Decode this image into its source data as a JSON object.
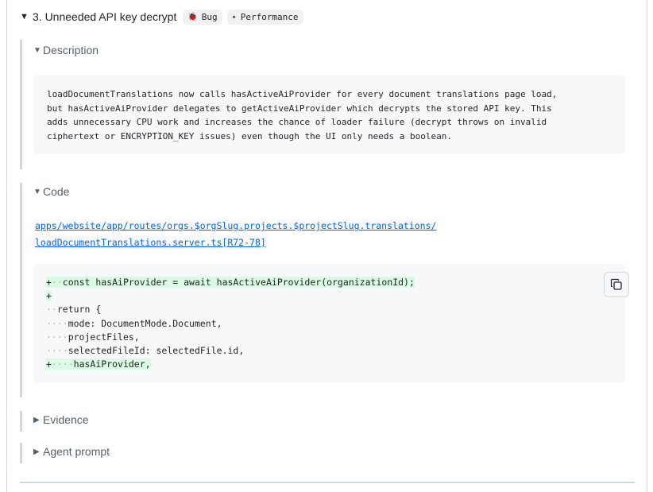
{
  "issue": {
    "caret": "▼",
    "title": "3. Unneeded API key decrypt",
    "tags": [
      {
        "icon": "bug-icon",
        "label": "Bug"
      },
      {
        "icon": "sparkle-icon",
        "label": "Performance"
      }
    ]
  },
  "description": {
    "caret": "▼",
    "label": "Description",
    "text": "loadDocumentTranslations now calls hasActiveAiProvider for every document translations page load,\nbut hasActiveAiProvider delegates to getActiveAiProvider which decrypts the stored API key. This\nadds unnecessary CPU work and increases the chance of loader failure (decrypt throws on invalid\nciphertext or ENCRYPTION_KEY issues) even though the UI only needs a boolean."
  },
  "code": {
    "caret": "▼",
    "label": "Code",
    "path_line1": "apps/website/app/routes/orgs.$orgSlug.projects.$projectSlug.translations/",
    "path_line2": "loadDocumentTranslations.server.ts[R72-78]",
    "lines": [
      {
        "added": true,
        "marker": "+",
        "ws": "··",
        "text": "const hasAiProvider = await hasActiveAiProvider(organizationId);"
      },
      {
        "added": true,
        "marker": "+",
        "ws": "",
        "text": ""
      },
      {
        "added": false,
        "marker": "",
        "ws": "··",
        "text": "return {"
      },
      {
        "added": false,
        "marker": "",
        "ws": "····",
        "text": "mode: DocumentMode.Document,"
      },
      {
        "added": false,
        "marker": "",
        "ws": "····",
        "text": "projectFiles,"
      },
      {
        "added": false,
        "marker": "",
        "ws": "····",
        "text": "selectedFileId: selectedFile.id,"
      },
      {
        "added": true,
        "marker": "+",
        "ws": "····",
        "text": "hasAiProvider,"
      }
    ]
  },
  "evidence": {
    "caret": "▶",
    "label": "Evidence"
  },
  "agent_prompt": {
    "caret": "▶",
    "label": "Agent prompt"
  }
}
